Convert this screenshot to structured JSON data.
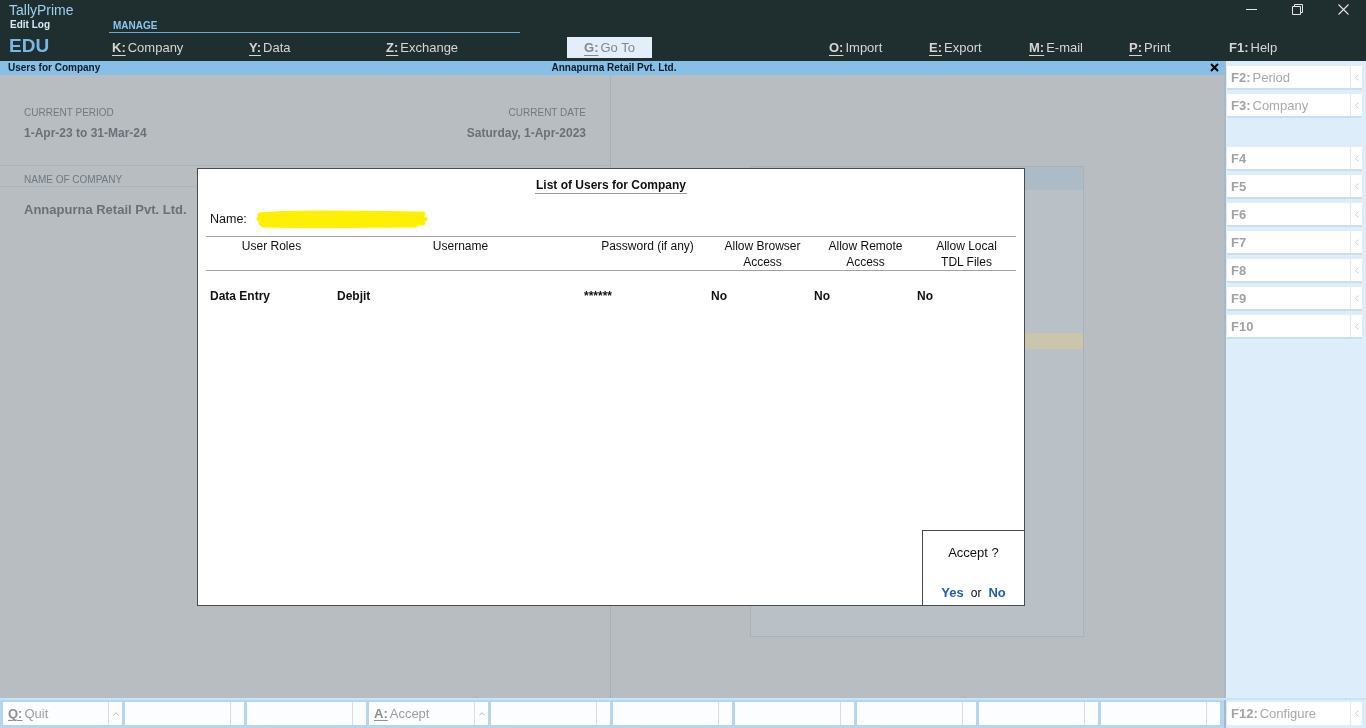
{
  "header": {
    "app_name": "TallyPrime",
    "mode": "Edit Log",
    "edition": "EDU",
    "section": "MANAGE",
    "manage_items": [
      {
        "key": "K:",
        "label": "Company",
        "underline": true
      },
      {
        "key": "Y:",
        "label": "Data",
        "underline": true
      },
      {
        "key": "Z:",
        "label": "Exchange",
        "underline": true
      }
    ],
    "goto": {
      "key": "G:",
      "label": "Go To",
      "underline": true,
      "disabled": true
    },
    "actions": [
      {
        "key": "O:",
        "label": "Import",
        "underline": true
      },
      {
        "key": "E:",
        "label": "Export",
        "underline": true
      },
      {
        "key": "M:",
        "label": "E-mail",
        "underline": true
      },
      {
        "key": "P:",
        "label": "Print",
        "underline": true
      },
      {
        "key": "F1:",
        "label": "Help",
        "underline": false
      }
    ]
  },
  "title_bar": {
    "screen": "Users for Company",
    "company": "Annapurna Retail Pvt. Ltd."
  },
  "company_info": {
    "period_label": "CURRENT PERIOD",
    "period": "1-Apr-23 to 31-Mar-24",
    "date_label": "CURRENT DATE",
    "date": "Saturday, 1-Apr-2023",
    "name_label": "NAME OF COMPANY",
    "name": "Annapurna Retail Pvt. Ltd."
  },
  "dialog": {
    "title": "List of Users for Company",
    "name_label": "Name:",
    "columns": [
      "User Roles",
      "Username",
      "Password (if any)",
      "Allow Browser Access",
      "Allow Remote Access",
      "Allow Local TDL Files"
    ],
    "rows": [
      {
        "cells": [
          "Data Entry",
          "Debjit",
          "******",
          "No",
          "No",
          "No"
        ]
      }
    ],
    "confirm": {
      "prompt": "Accept ?",
      "joiner": "or",
      "options": [
        {
          "label": "Yes"
        },
        {
          "label": "No"
        }
      ]
    }
  },
  "sidebar": {
    "groups": [
      {
        "buttons": [
          {
            "key": "F2:",
            "label": "Period"
          },
          {
            "key": "F3:",
            "label": "Company"
          }
        ]
      },
      {
        "buttons": [
          {
            "key": "F4"
          },
          {
            "key": "F5"
          },
          {
            "key": "F6"
          },
          {
            "key": "F7"
          },
          {
            "key": "F8"
          },
          {
            "key": "F9"
          },
          {
            "key": "F10"
          }
        ]
      }
    ]
  },
  "footer": {
    "buttons": [
      {
        "kind": "action",
        "key": "Q:",
        "label": "Quit",
        "underline": true
      },
      {
        "kind": "blank"
      },
      {
        "kind": "blank"
      },
      {
        "kind": "action",
        "key": "A:",
        "label": "Accept",
        "underline": true
      },
      {
        "kind": "blank"
      },
      {
        "kind": "blank"
      },
      {
        "kind": "blank"
      },
      {
        "kind": "blank"
      },
      {
        "kind": "blank"
      },
      {
        "kind": "blank"
      }
    ],
    "configure": {
      "key": "F12:",
      "label": "Configure"
    }
  }
}
